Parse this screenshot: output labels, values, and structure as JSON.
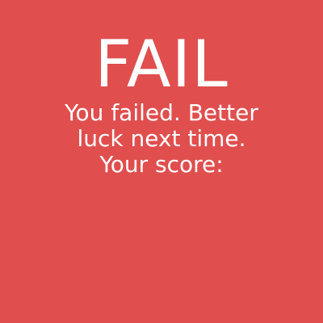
{
  "screen": {
    "background_color": "#E04E4E",
    "text_color": "#FFFFFF",
    "title": "FAIL",
    "message_lines": [
      "You failed. Better",
      "luck next time.",
      "Your score:"
    ]
  }
}
